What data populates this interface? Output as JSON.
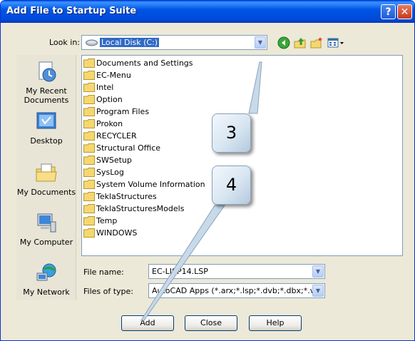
{
  "window": {
    "title": "Add File to Startup Suite"
  },
  "titlebar_buttons": {
    "help": "?",
    "close": "✕"
  },
  "look_in": {
    "label": "Look in:",
    "value": "Local Disk (C:)"
  },
  "places": [
    {
      "label": "My Recent Documents"
    },
    {
      "label": "Desktop"
    },
    {
      "label": "My Documents"
    },
    {
      "label": "My Computer"
    },
    {
      "label": "My Network"
    }
  ],
  "files": [
    "Documents and Settings",
    "EC-Menu",
    "Intel",
    "Option",
    "Program Files",
    "Prokon",
    "RECYCLER",
    "Structural Office",
    "SWSetup",
    "SysLog",
    "System Volume Information",
    "TeklaStructures",
    "TeklaStructuresModels",
    "Temp",
    "WINDOWS"
  ],
  "file_name": {
    "label": "File name:",
    "value": "EC-LISP14.LSP"
  },
  "files_of_type": {
    "label": "Files of type:",
    "value": "AutoCAD Apps (*.arx;*.lsp;*.dvb;*.dbx;*.vlx;*.fas"
  },
  "buttons": {
    "add": "Add",
    "close": "Close",
    "help": "Help"
  },
  "callouts": [
    "3",
    "4"
  ],
  "colors": {
    "titlebar": "#0055e5",
    "selection": "#316ac5",
    "folder": "#f5d772",
    "dialog": "#ece9d8"
  }
}
